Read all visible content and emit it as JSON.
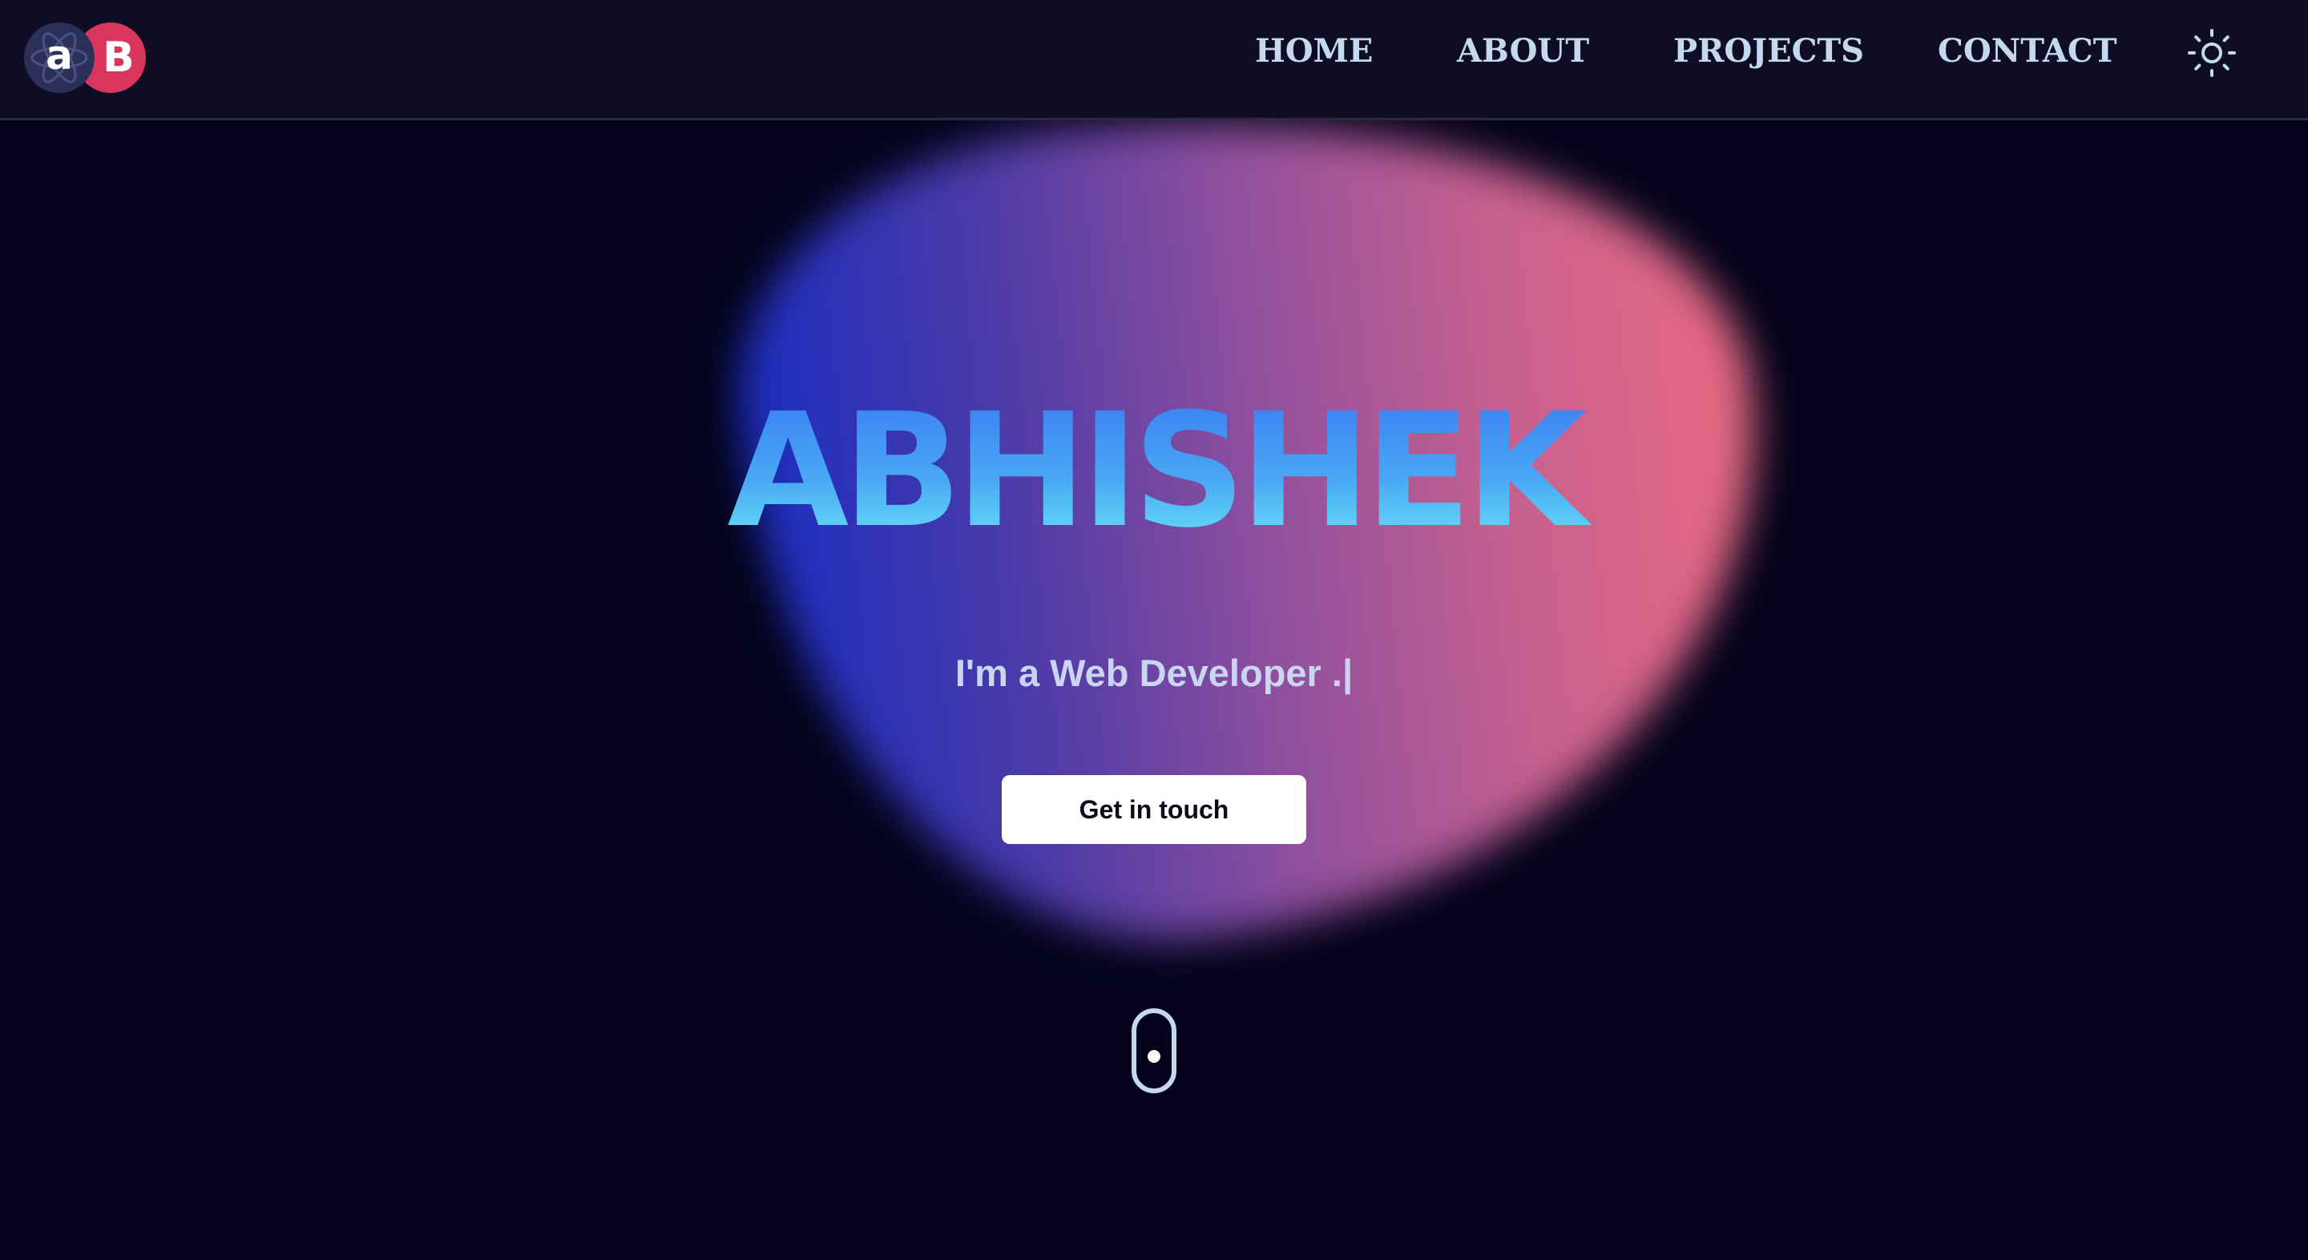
{
  "header": {
    "logo": {
      "letter_left": "a",
      "letter_right": "B",
      "colors": {
        "left_circle": "#2b3058",
        "right_circle": "#d8365a"
      }
    },
    "nav": [
      {
        "label": "HOME"
      },
      {
        "label": "ABOUT"
      },
      {
        "label": "PROJECTS"
      },
      {
        "label": "CONTACT"
      }
    ],
    "theme_toggle_icon": "sun-icon"
  },
  "hero": {
    "name": "ABHISHEK",
    "subtitle": "I'm a Web Developer .|",
    "cta_label": "Get in touch",
    "scroll_icon": "mouse-scroll-icon"
  },
  "colors": {
    "background": "#03021a",
    "header_bg": "#0e0d24",
    "nav_text": "#c4d8ef",
    "blob_start": "#1a2ec2",
    "blob_end": "#ea6a82",
    "title_gradient_top": "#3b7ef2",
    "title_gradient_bottom": "#68e4f7"
  }
}
